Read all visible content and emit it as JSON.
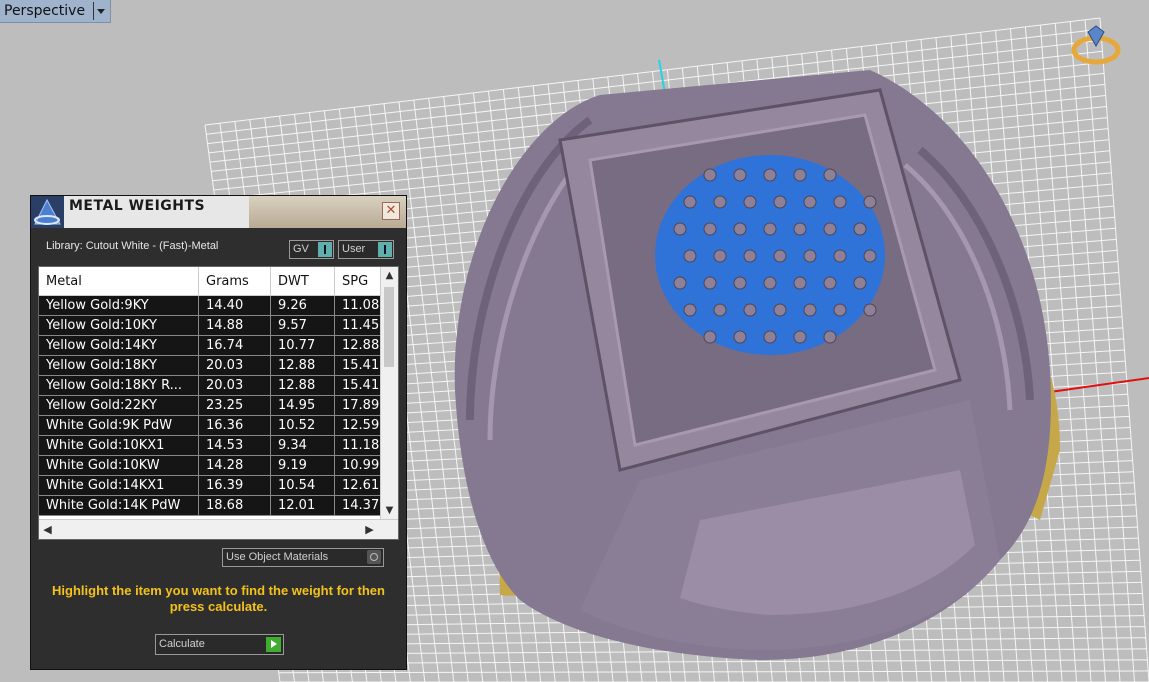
{
  "viewport": {
    "label": "Perspective"
  },
  "panel": {
    "title": "METAL WEIGHTS",
    "close_glyph": "✕",
    "library_label": "Library: Cutout White - (Fast)-Metal",
    "gv_label": "GV",
    "user_label": "User",
    "columns": [
      "Metal",
      "Grams",
      "DWT",
      "SPG"
    ],
    "rows": [
      {
        "metal": "Yellow Gold:9KY",
        "grams": "14.40",
        "dwt": "9.26",
        "spg": "11.08"
      },
      {
        "metal": "Yellow Gold:10KY",
        "grams": "14.88",
        "dwt": "9.57",
        "spg": "11.45"
      },
      {
        "metal": "Yellow Gold:14KY",
        "grams": "16.74",
        "dwt": "10.77",
        "spg": "12.88"
      },
      {
        "metal": "Yellow Gold:18KY",
        "grams": "20.03",
        "dwt": "12.88",
        "spg": "15.41"
      },
      {
        "metal": "Yellow Gold:18KY R...",
        "grams": "20.03",
        "dwt": "12.88",
        "spg": "15.41"
      },
      {
        "metal": "Yellow Gold:22KY",
        "grams": "23.25",
        "dwt": "14.95",
        "spg": "17.89"
      },
      {
        "metal": "White Gold:9K PdW",
        "grams": "16.36",
        "dwt": "10.52",
        "spg": "12.59"
      },
      {
        "metal": "White Gold:10KX1",
        "grams": "14.53",
        "dwt": "9.34",
        "spg": "11.18"
      },
      {
        "metal": "White Gold:10KW",
        "grams": "14.28",
        "dwt": "9.19",
        "spg": "10.99"
      },
      {
        "metal": "White Gold:14KX1",
        "grams": "16.39",
        "dwt": "10.54",
        "spg": "12.61"
      },
      {
        "metal": "White Gold:14K PdW",
        "grams": "18.68",
        "dwt": "12.01",
        "spg": "14.37"
      }
    ],
    "use_object_materials_label": "Use Object Materials",
    "instruction": "Highlight the item you want to find the weight for then press calculate.",
    "calculate_label": "Calculate"
  },
  "colors": {
    "accent_yellow": "#f4c21c",
    "ring_metal": "#8a7c93",
    "gem_blue": "#2f73d8",
    "gold_texture": "#c9a646"
  }
}
